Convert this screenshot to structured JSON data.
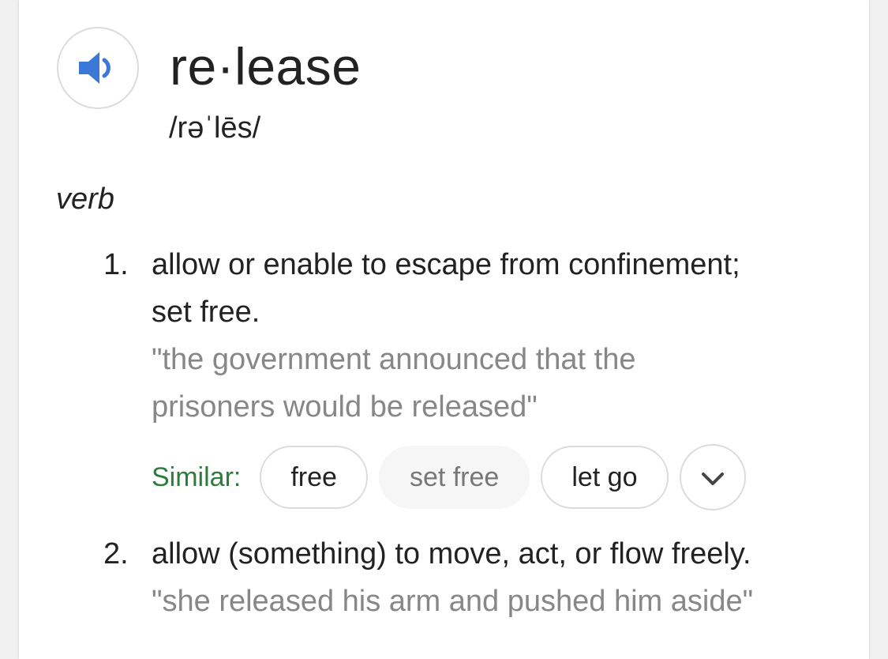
{
  "entry": {
    "headword": "re·lease",
    "phonetic": "/rəˈlēs/",
    "audio_icon": "speaker-icon",
    "part_of_speech": "verb"
  },
  "senses": [
    {
      "number": "1.",
      "definition_line1": "allow or enable to escape from confinement;",
      "definition_line2": "set free.",
      "example_line1": "\"the government announced that the",
      "example_line2": "prisoners would be released\""
    },
    {
      "number": "2.",
      "definition_line1": "allow (something) to move, act, or flow freely.",
      "example_line1": "\"she released his arm and pushed him aside\""
    }
  ],
  "similar": {
    "label": "Similar:",
    "chips": [
      "free",
      "set free",
      "let go"
    ],
    "expand_icon": "chevron-down-icon"
  },
  "colors": {
    "accent_blue": "#3c78d8",
    "similar_green": "#2d7d3a",
    "example_gray": "#878787"
  }
}
